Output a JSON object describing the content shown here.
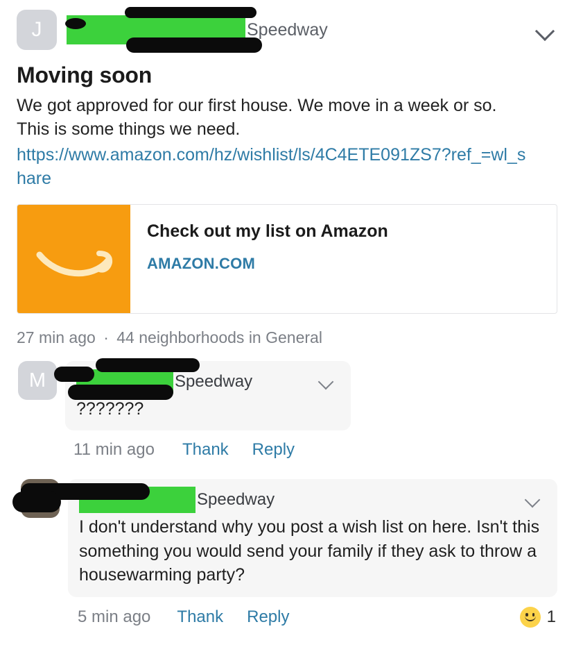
{
  "post": {
    "author_initial": "J",
    "author_name_redacted": true,
    "neighborhood": "Speedway",
    "expand_icon": "chevron-down-icon",
    "title": "Moving soon",
    "text": "We got approved for our first house. We move in a week or so. This is some things we need.",
    "link_url": "https://www.amazon.com/hz/wishlist/ls/4C4ETE091ZS7?ref_=wl_share",
    "meta_time": "27 min ago",
    "meta_separator": "·",
    "meta_audience": "44 neighborhoods in General"
  },
  "link_preview": {
    "thumbnail_icon": "amazon-smile-icon",
    "thumbnail_color": "#F79C10",
    "title": "Check out my list on Amazon",
    "domain": "AMAZON.COM"
  },
  "comments": [
    {
      "author_initial": "M",
      "author_name_redacted": true,
      "neighborhood": "Speedway",
      "expand_icon": "chevron-down-icon",
      "body": "???????",
      "timestamp": "11 min ago",
      "thank_label": "Thank",
      "reply_label": "Reply",
      "reaction": null
    },
    {
      "author_avatar": "photo-avatar",
      "author_name_redacted": true,
      "neighborhood": "Speedway",
      "expand_icon": "chevron-down-icon",
      "body": "I don't understand why you post a wish list on here. Isn't this something you would send your family if they ask to throw a housewarming party?",
      "timestamp": "5 min ago",
      "thank_label": "Thank",
      "reply_label": "Reply",
      "reaction": {
        "emoji": "slightly-smiling-face",
        "count": "1"
      }
    }
  ],
  "colors": {
    "link": "#2E7BA6",
    "muted_text": "#7B7F86",
    "redaction_green": "#3CD13C",
    "redaction_black": "#0B0B0B",
    "bubble_bg": "#F6F6F6",
    "avatar_bg": "#D3D5DA"
  }
}
